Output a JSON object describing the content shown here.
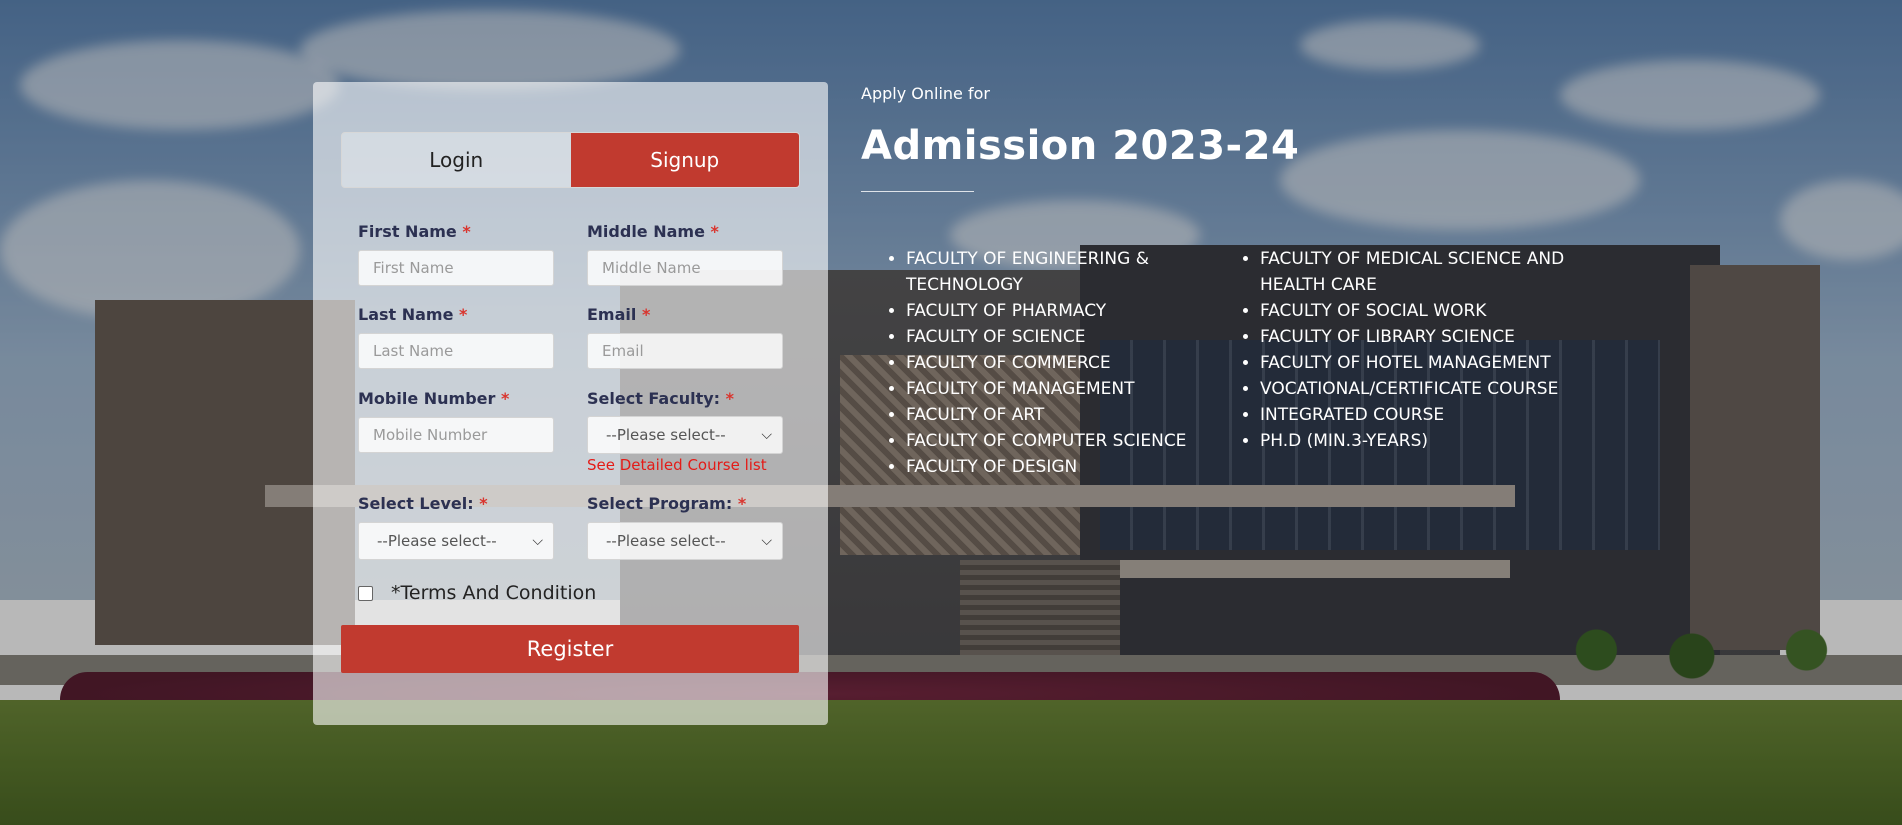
{
  "tabs": {
    "login": "Login",
    "signup": "Signup"
  },
  "form": {
    "first_name": {
      "label": "First Name",
      "required": "*",
      "placeholder": "First Name"
    },
    "middle_name": {
      "label": "Middle Name",
      "required": "*",
      "placeholder": "Middle Name"
    },
    "last_name": {
      "label": "Last Name",
      "required": "*",
      "placeholder": "Last Name"
    },
    "email": {
      "label": "Email",
      "required": "*",
      "placeholder": "Email"
    },
    "mobile": {
      "label": "Mobile Number",
      "required": "*",
      "placeholder": "Mobile Number"
    },
    "faculty": {
      "label": "Select Faculty:",
      "required": "*",
      "value": "--Please select--"
    },
    "course_link": "See Detailed Course list",
    "level": {
      "label": "Select Level:",
      "required": "*",
      "value": "--Please select--"
    },
    "program": {
      "label": "Select Program:",
      "required": "*",
      "value": "--Please select--"
    },
    "terms_label": "*Terms And Condition",
    "register_label": "Register"
  },
  "info": {
    "apply_label": "Apply Online for",
    "title": "Admission 2023-24",
    "faculties_left": [
      "FACULTY OF ENGINEERING & TECHNOLOGY",
      "FACULTY OF PHARMACY",
      "FACULTY OF SCIENCE",
      "FACULTY OF COMMERCE",
      "FACULTY OF MANAGEMENT",
      "FACULTY OF ART",
      "FACULTY OF COMPUTER SCIENCE",
      "FACULTY OF DESIGN"
    ],
    "faculties_right": [
      "FACULTY OF MEDICAL SCIENCE AND HEALTH CARE",
      "FACULTY OF SOCIAL WORK",
      "FACULTY OF LIBRARY SCIENCE",
      "FACULTY OF HOTEL MANAGEMENT",
      "VOCATIONAL/CERTIFICATE COURSE",
      "INTEGRATED COURSE",
      "PH.D (MIN.3-YEARS)"
    ]
  },
  "icons": {
    "select_chevron": "chevron-down-icon"
  },
  "colors": {
    "accent": "#c13a2f",
    "link": "#e41b17",
    "label": "#2c3152"
  }
}
